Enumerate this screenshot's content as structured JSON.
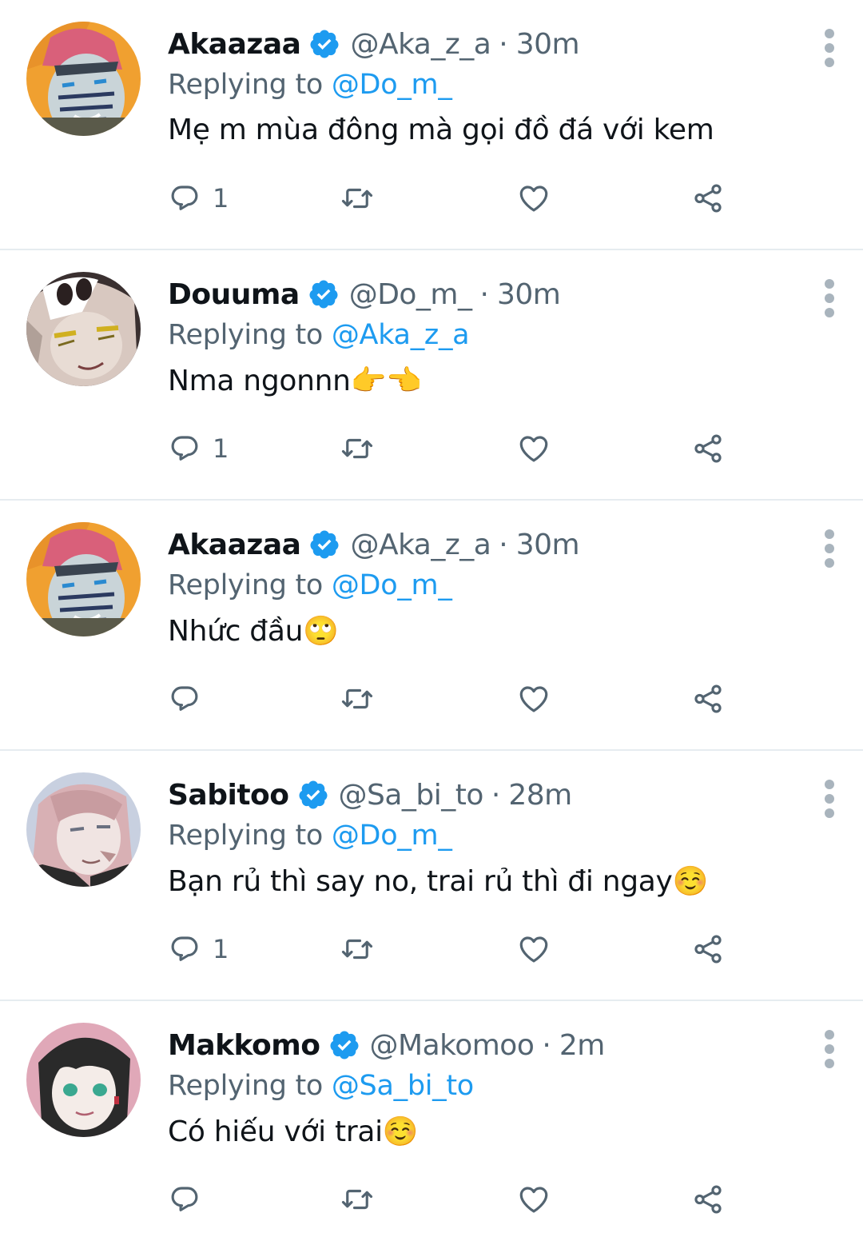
{
  "colors": {
    "text": "#0f1419",
    "muted": "#536471",
    "accent": "#1d9bf0",
    "divider": "#e6ecf0"
  },
  "tweets": [
    {
      "name": "Akaazaa",
      "handle": "@Aka_z_a",
      "dot": "·",
      "time": "30m",
      "replying_label": "Replying to",
      "replying_to": "@Do_m_",
      "text": "Mẹ m mùa đông mà gọi đồ đá với kem",
      "reply_count": "1",
      "avatar_icon": "akaza-avatar"
    },
    {
      "name": "Douuma",
      "handle": "@Do_m_",
      "dot": "·",
      "time": "30m",
      "replying_label": "Replying to",
      "replying_to": "@Aka_z_a",
      "text": "Nma ngonnn👉👈",
      "reply_count": "1",
      "avatar_icon": "douma-avatar"
    },
    {
      "name": "Akaazaa",
      "handle": "@Aka_z_a",
      "dot": "·",
      "time": "30m",
      "replying_label": "Replying to",
      "replying_to": "@Do_m_",
      "text": "Nhức đầu🙄",
      "reply_count": "",
      "avatar_icon": "akaza-avatar"
    },
    {
      "name": "Sabitoo",
      "handle": "@Sa_bi_to",
      "dot": "·",
      "time": "28m",
      "replying_label": "Replying to",
      "replying_to": "@Do_m_",
      "text": "Bạn rủ thì say no, trai rủ thì đi ngay☺️",
      "reply_count": "1",
      "avatar_icon": "sabito-avatar"
    },
    {
      "name": "Makkomo",
      "handle": "@Makomoo",
      "dot": "·",
      "time": "2m",
      "replying_label": "Replying to",
      "replying_to": "@Sa_bi_to",
      "text": "Có hiếu với trai☺️",
      "reply_count": "",
      "avatar_icon": "makomo-avatar"
    }
  ]
}
